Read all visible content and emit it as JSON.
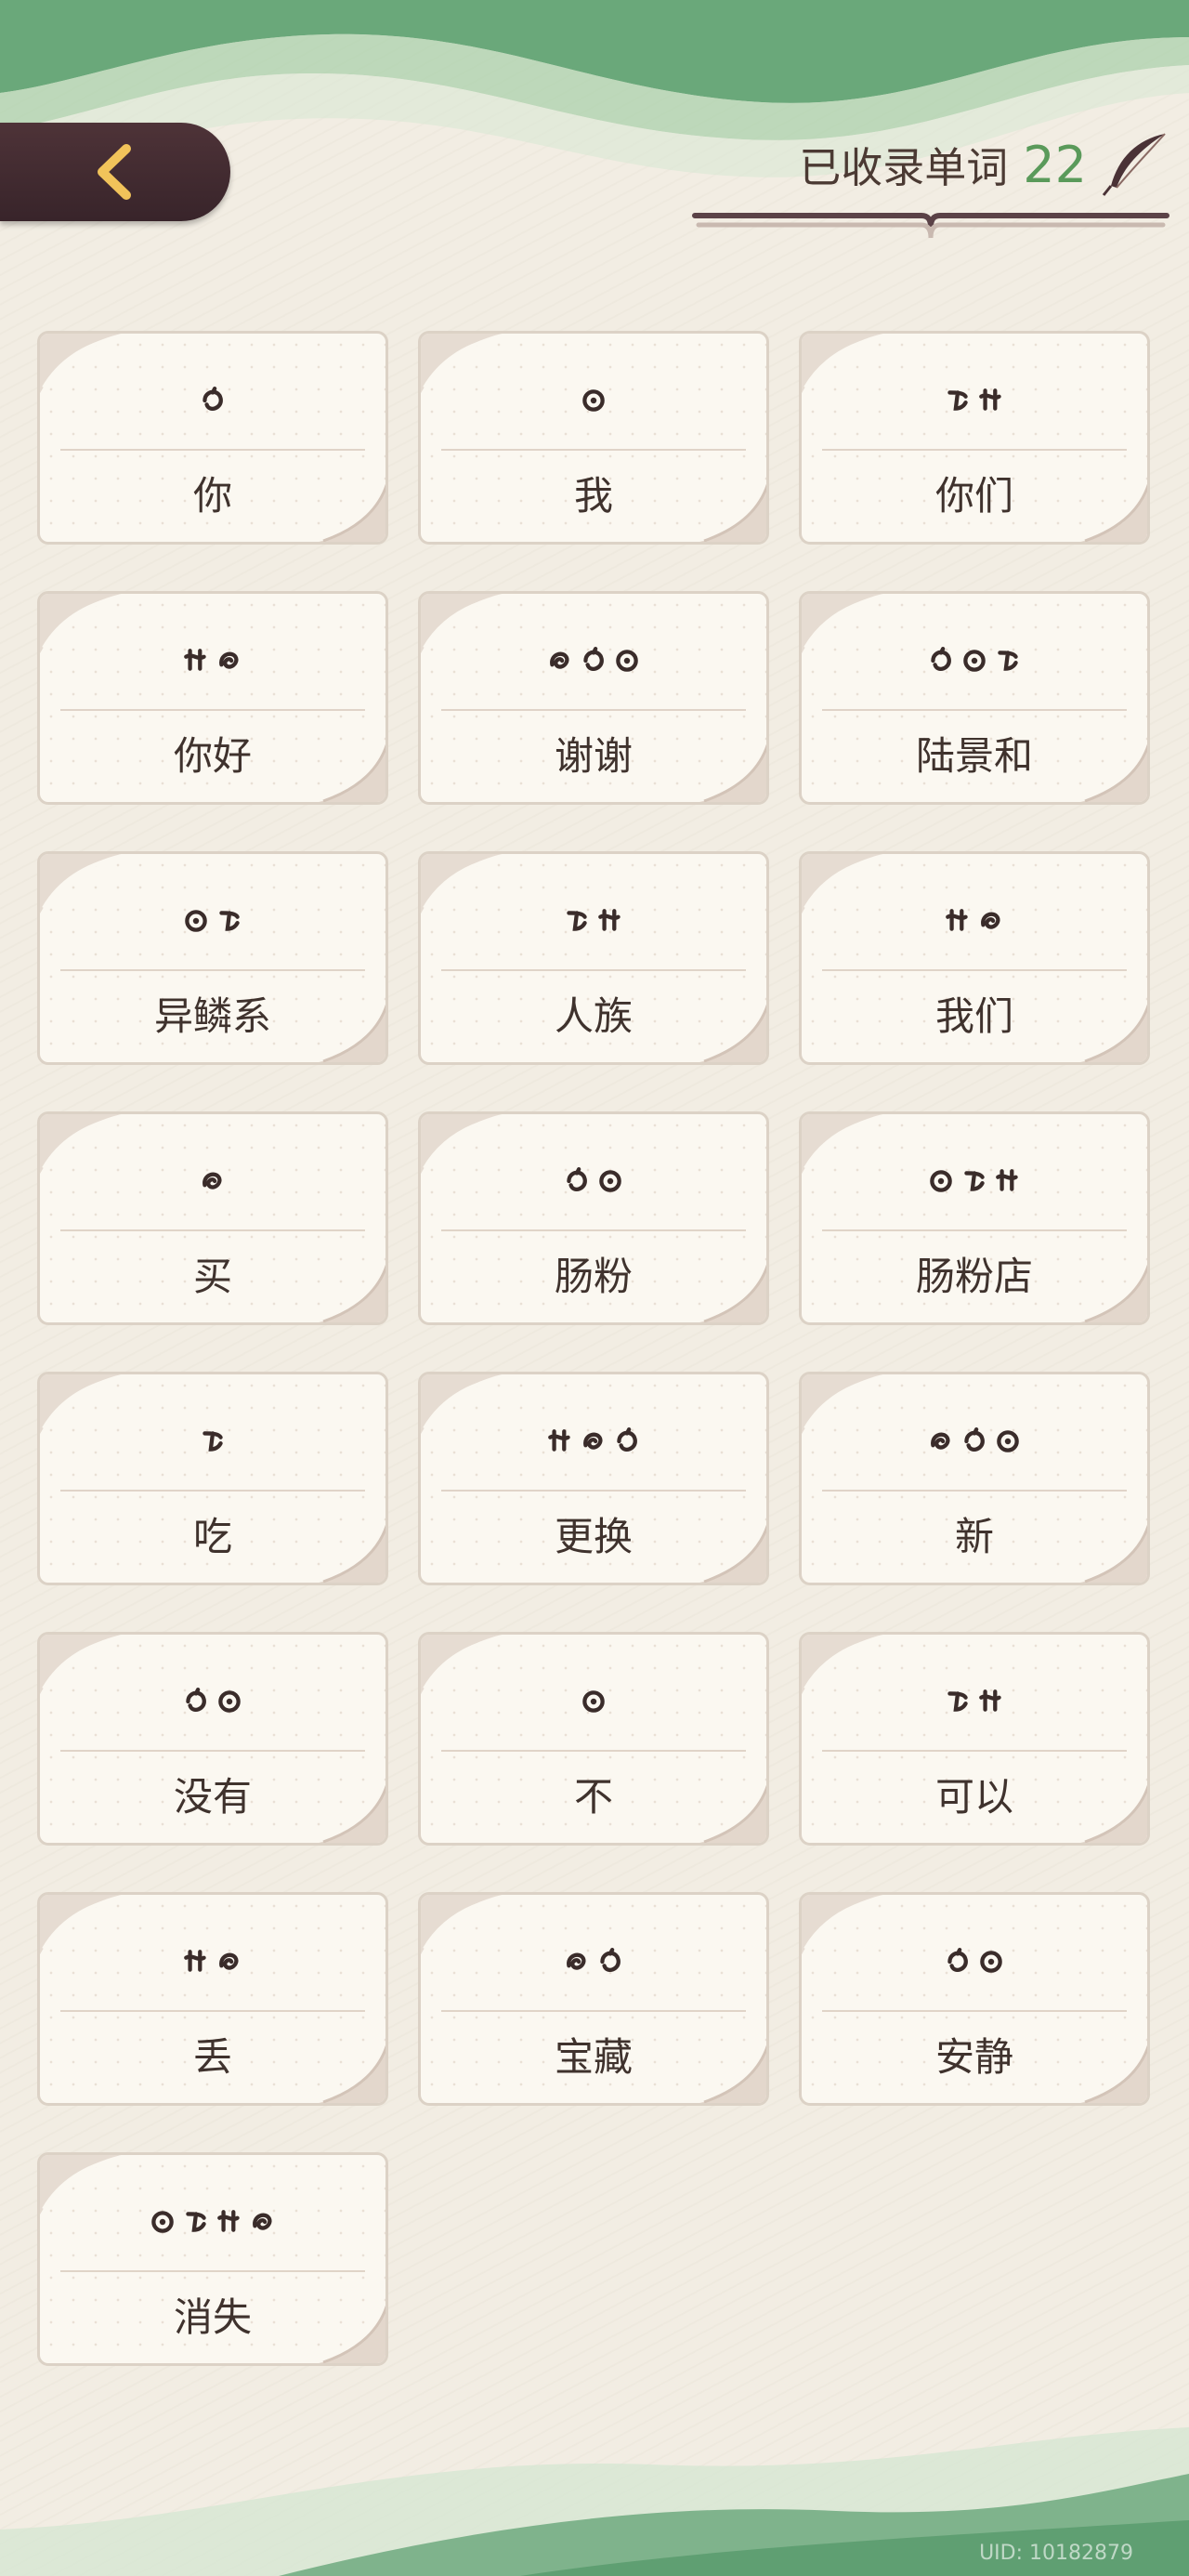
{
  "header": {
    "counter_label": "已收录单词",
    "counter_value": "22"
  },
  "icons": {
    "back": "chevron-left-icon",
    "quill": "quill-icon",
    "book": "open-book-icon"
  },
  "colors": {
    "accent_green": "#5a9a5a",
    "back_button": "#452d33",
    "card_bg": "#fbf8f1"
  },
  "words": [
    {
      "meaning": "你",
      "glyph_count": 1
    },
    {
      "meaning": "我",
      "glyph_count": 1
    },
    {
      "meaning": "你们",
      "glyph_count": 2
    },
    {
      "meaning": "你好",
      "glyph_count": 2
    },
    {
      "meaning": "谢谢",
      "glyph_count": 3
    },
    {
      "meaning": "陆景和",
      "glyph_count": 3
    },
    {
      "meaning": "异鳞系",
      "glyph_count": 2
    },
    {
      "meaning": "人族",
      "glyph_count": 2
    },
    {
      "meaning": "我们",
      "glyph_count": 2
    },
    {
      "meaning": "买",
      "glyph_count": 1
    },
    {
      "meaning": "肠粉",
      "glyph_count": 2
    },
    {
      "meaning": "肠粉店",
      "glyph_count": 3
    },
    {
      "meaning": "吃",
      "glyph_count": 1
    },
    {
      "meaning": "更换",
      "glyph_count": 3
    },
    {
      "meaning": "新",
      "glyph_count": 3
    },
    {
      "meaning": "没有",
      "glyph_count": 2
    },
    {
      "meaning": "不",
      "glyph_count": 1
    },
    {
      "meaning": "可以",
      "glyph_count": 2
    },
    {
      "meaning": "丢",
      "glyph_count": 2
    },
    {
      "meaning": "宝藏",
      "glyph_count": 2
    },
    {
      "meaning": "安静",
      "glyph_count": 2
    },
    {
      "meaning": "消失",
      "glyph_count": 4
    }
  ],
  "footer": {
    "uid": "UID: 10182879"
  }
}
